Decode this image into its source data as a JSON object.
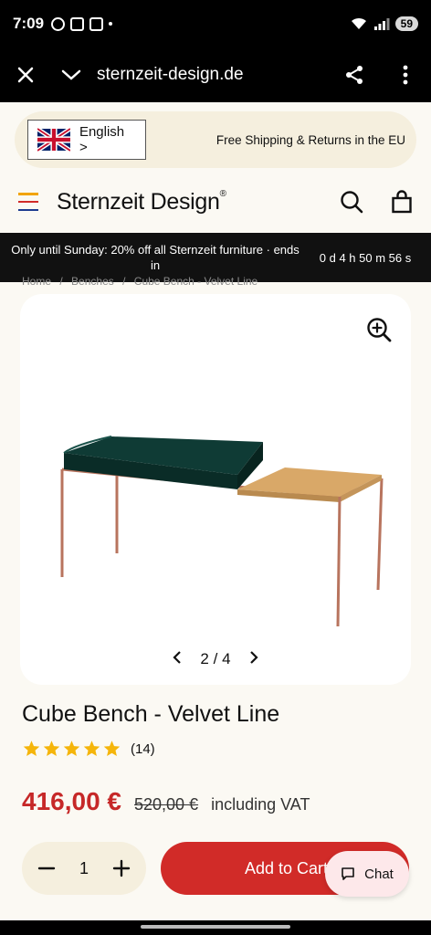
{
  "status_bar": {
    "time": "7:09",
    "battery": "59"
  },
  "browser": {
    "url": "sternzeit-design.de",
    "close_icon": "close-icon",
    "menu_icon": "more-vertical-icon"
  },
  "lang_bar": {
    "language": "English",
    "chevron": ">",
    "shipping": "Free Shipping & Returns in the EU"
  },
  "header": {
    "brand": "Sternzeit Design",
    "trademark": "®"
  },
  "promo": {
    "text": "Only until Sunday: 20% off all Sternzeit furniture · ends in",
    "timer": "0 d 4 h 50 m 56 s"
  },
  "breadcrumb": {
    "items": [
      "Home",
      "/",
      "Benches",
      "/",
      "Cube Bench - Velvet Line"
    ]
  },
  "gallery": {
    "current": "2",
    "separator": "/",
    "total": "4"
  },
  "product": {
    "title": "Cube Bench - Velvet Line",
    "rating": 5,
    "review_count": "(14)",
    "price": "416,00 €",
    "old_price": "520,00 €",
    "vat": "including VAT"
  },
  "cart": {
    "quantity": "1",
    "add_label": "Add to Cart",
    "chat_label": "Chat"
  },
  "colors": {
    "accent": "#d12b28",
    "price": "#c62828",
    "star": "#f5b50a",
    "cream": "#f5efde",
    "promo_bg": "#111111"
  }
}
